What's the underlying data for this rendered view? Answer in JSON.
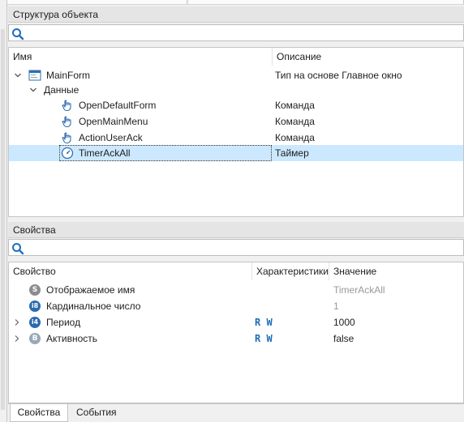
{
  "structure_panel": {
    "title": "Структура объекта",
    "columns": {
      "name": "Имя",
      "description": "Описание"
    },
    "rows": [
      {
        "name": "MainForm",
        "description": "Тип на основе Главное окно",
        "icon": "form-icon"
      },
      {
        "name": "Данные",
        "description": "",
        "icon": ""
      },
      {
        "name": "OpenDefaultForm",
        "description": "Команда",
        "icon": "hand-pointer-icon"
      },
      {
        "name": "OpenMainMenu",
        "description": "Команда",
        "icon": "hand-pointer-icon"
      },
      {
        "name": "ActionUserAck",
        "description": "Команда",
        "icon": "hand-pointer-icon"
      },
      {
        "name": "TimerAckAll",
        "description": "Таймер",
        "icon": "timer-icon"
      }
    ]
  },
  "properties_panel": {
    "title": "Свойства",
    "columns": {
      "property": "Свойство",
      "characteristics": "Характеристики",
      "value": "Значение"
    },
    "rows": [
      {
        "badge": "S",
        "badge_color": "#8c8c8c",
        "name": "Отображаемое имя",
        "characteristics": "",
        "value": "TimerAckAll"
      },
      {
        "badge": "i8",
        "badge_color": "#2b6cb0",
        "name": "Кардинальное число",
        "characteristics": "",
        "value": "1"
      },
      {
        "badge": "i4",
        "badge_color": "#2b6cb0",
        "name": "Период",
        "characteristics": "R W",
        "value": "1000"
      },
      {
        "badge": "B",
        "badge_color": "#9aa8b8",
        "name": "Активность",
        "characteristics": "R W",
        "value": "false"
      }
    ]
  },
  "bottom_tabs": [
    "Свойства",
    "События"
  ]
}
